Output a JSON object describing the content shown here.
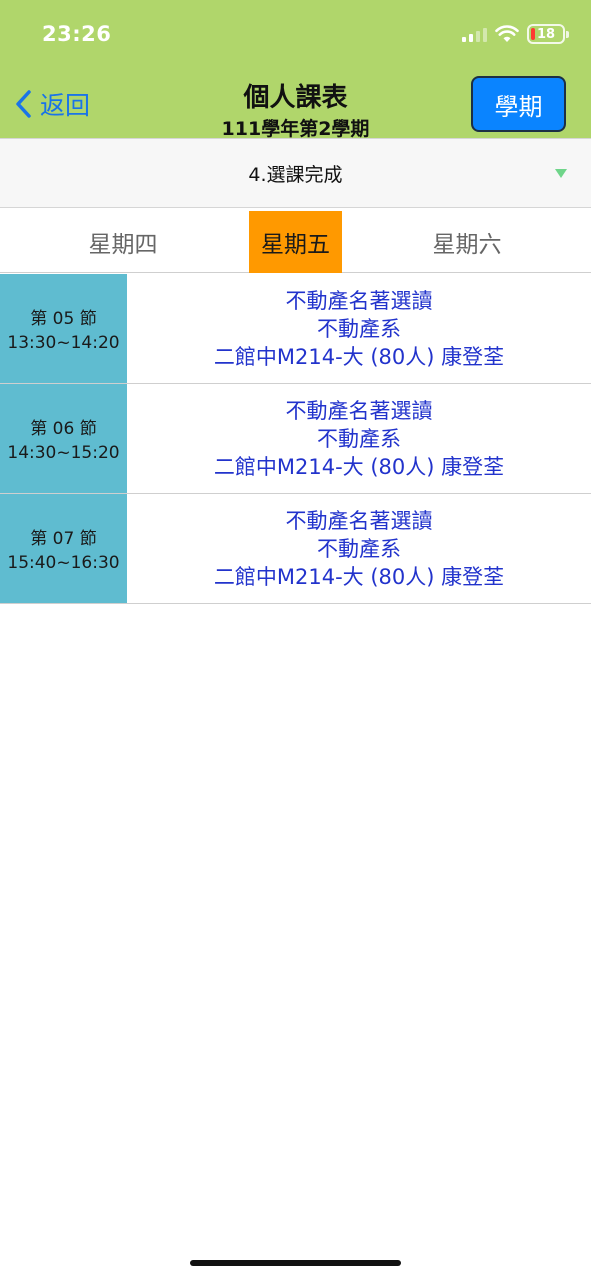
{
  "status_bar": {
    "time": "23:26",
    "battery": "18"
  },
  "nav": {
    "back_label": "返回",
    "title": "個人課表",
    "subtitle": "111學年第2學期",
    "term_button": "學期"
  },
  "dropdown": {
    "value": "4.選課完成"
  },
  "tabs": [
    {
      "label": "星期四",
      "selected": false
    },
    {
      "label": "星期五",
      "selected": true
    },
    {
      "label": "星期六",
      "selected": false
    }
  ],
  "periods": [
    {
      "name": "第 05 節",
      "time": "13:30~14:20",
      "course": "不動產名著選讀",
      "dept": "不動產系",
      "room": "二館中M214-大 (80人) 康登荃"
    },
    {
      "name": "第 06 節",
      "time": "14:30~15:20",
      "course": "不動產名著選讀",
      "dept": "不動產系",
      "room": "二館中M214-大 (80人) 康登荃"
    },
    {
      "name": "第 07 節",
      "time": "15:40~16:30",
      "course": "不動產名著選讀",
      "dept": "不動產系",
      "room": "二館中M214-大 (80人) 康登荃"
    }
  ],
  "colors": {
    "header_bg": "#b0d66b",
    "accent_blue": "#0a84ff",
    "selected_tab": "#ff9900",
    "period_bg": "#5fbcd0",
    "course_text": "#2233cc"
  }
}
